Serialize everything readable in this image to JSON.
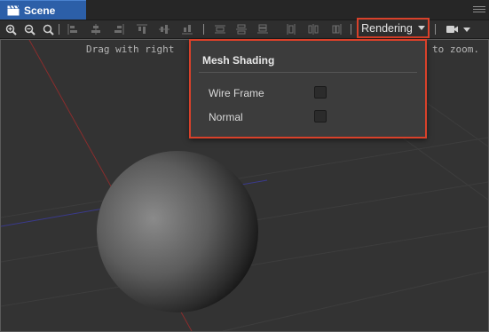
{
  "tab": {
    "title": "Scene",
    "icon": "scene-clapper-icon"
  },
  "panel_menu_icon": "hamburger-menu-icon",
  "toolbar": {
    "buttons": [
      "zoom-in-icon",
      "zoom-out-icon",
      "zoom-reset-icon",
      "align-left-icon",
      "align-h-center-icon",
      "align-right-icon",
      "align-top-icon",
      "align-v-center-icon",
      "align-bottom-icon",
      "distribute-left-icon",
      "distribute-h-center-icon",
      "distribute-right-icon",
      "distribute-top-icon",
      "distribute-v-center-icon",
      "distribute-bottom-icon"
    ],
    "rendering_label": "Rendering",
    "camera_icon": "camera-icon"
  },
  "viewport": {
    "hint_left": "Drag with right",
    "hint_right": "to zoom."
  },
  "dropdown": {
    "header": "Mesh Shading",
    "options": [
      {
        "label": "Wire Frame",
        "checked": false
      },
      {
        "label": "Normal",
        "checked": false
      }
    ]
  },
  "colors": {
    "accent_tab": "#2c5fa8",
    "highlight_border": "#d9412a",
    "viewport_bg": "#333333"
  }
}
